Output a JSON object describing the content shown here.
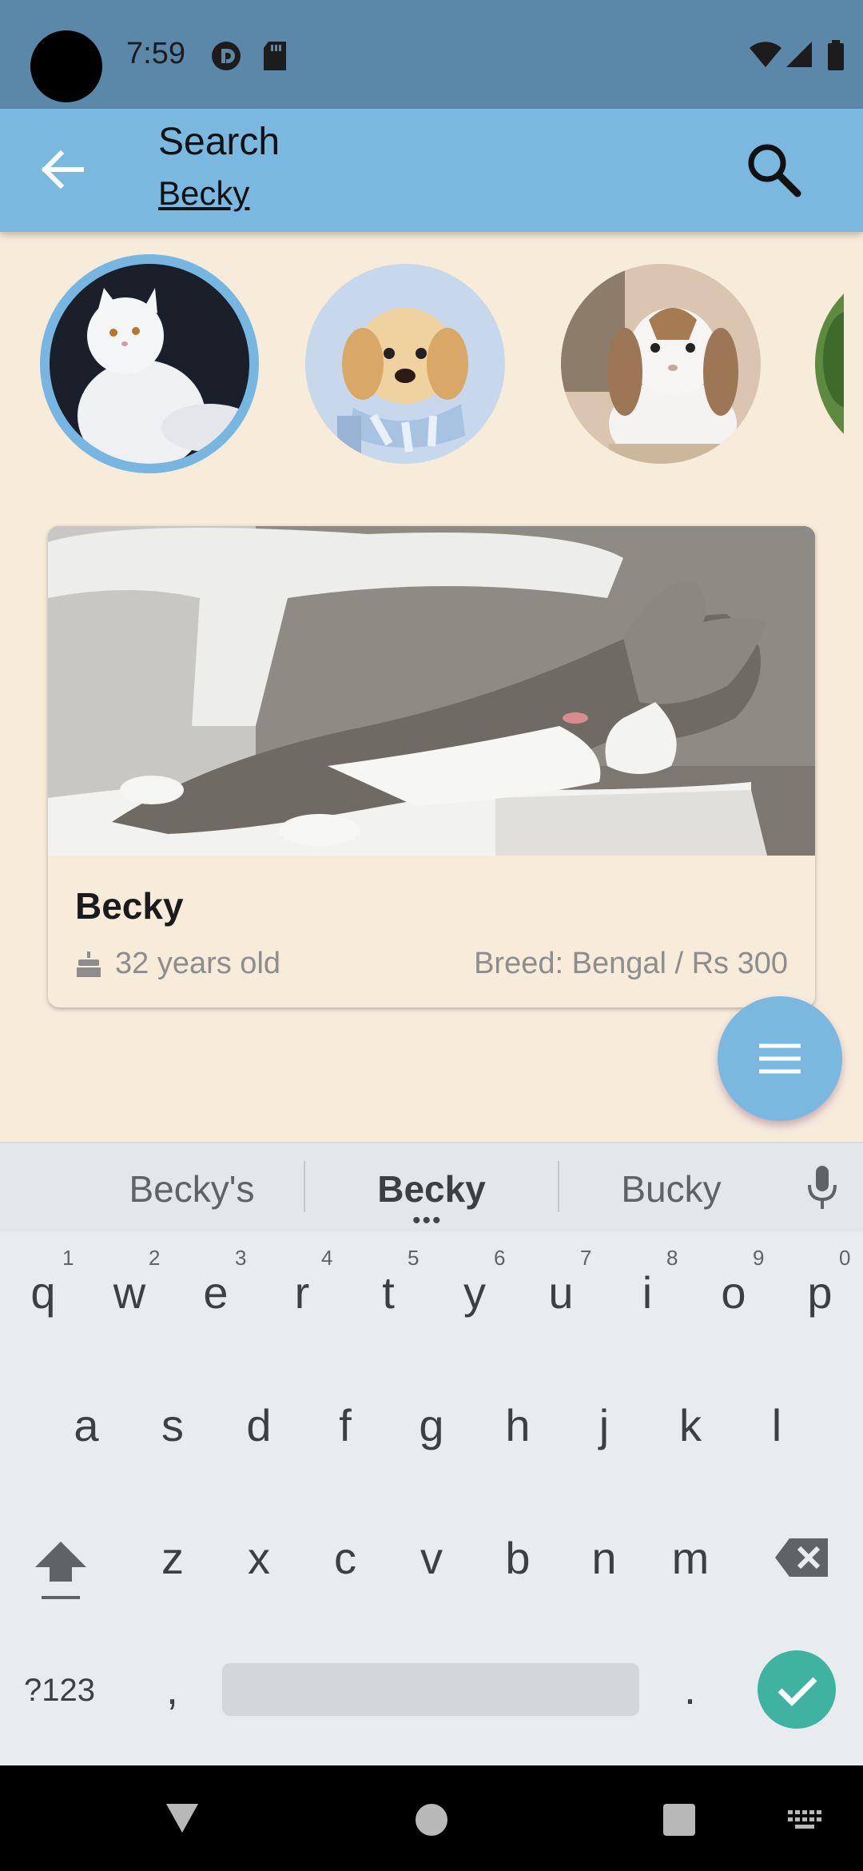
{
  "status_bar": {
    "time": "7:59"
  },
  "app_bar": {
    "title": "Search",
    "query": "Becky"
  },
  "avatars": [
    "cat-persian",
    "puppy-golden",
    "bunny-lop",
    "partial-pet"
  ],
  "card": {
    "name": "Becky",
    "age": "32 years old",
    "breed": "Breed: Bengal / Rs 300"
  },
  "keyboard": {
    "suggestions": [
      "Becky's",
      "Becky",
      "Bucky"
    ],
    "row1": [
      "q",
      "w",
      "e",
      "r",
      "t",
      "y",
      "u",
      "i",
      "o",
      "p"
    ],
    "row1_hints": [
      "1",
      "2",
      "3",
      "4",
      "5",
      "6",
      "7",
      "8",
      "9",
      "0"
    ],
    "row2": [
      "a",
      "s",
      "d",
      "f",
      "g",
      "h",
      "j",
      "k",
      "l"
    ],
    "row3": [
      "z",
      "x",
      "c",
      "v",
      "b",
      "n",
      "m"
    ],
    "symbols_label": "?123",
    "comma": ",",
    "period": "."
  },
  "colors": {
    "status_bar": "#5b87a9",
    "app_bar": "#7ab8e0",
    "background": "#f7ebda",
    "accent": "#3fb3a0"
  }
}
